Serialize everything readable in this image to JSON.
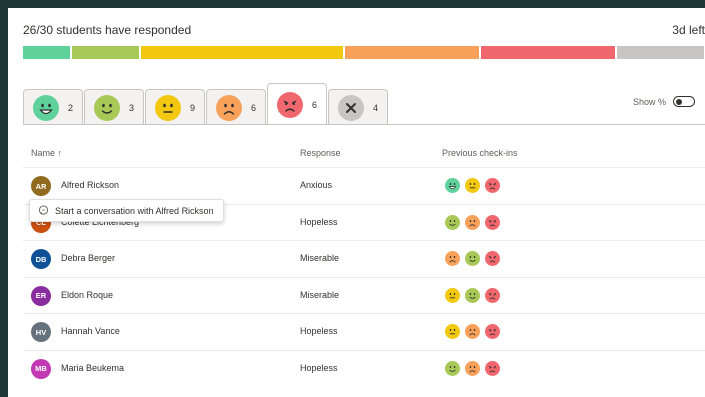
{
  "header": {
    "responded_text": "26/30 students have responded",
    "time_left": "3d left"
  },
  "progress": [
    {
      "name": "great",
      "share": 0.07,
      "color": "#5fd19a"
    },
    {
      "name": "good",
      "share": 0.1,
      "color": "#a8c957"
    },
    {
      "name": "okay",
      "share": 0.3,
      "color": "#f2c811"
    },
    {
      "name": "sad",
      "share": 0.2,
      "color": "#f7a15b"
    },
    {
      "name": "upset",
      "share": 0.2,
      "color": "#f0686e"
    },
    {
      "name": "no-response",
      "share": 0.13,
      "color": "#c8c6c4"
    }
  ],
  "tabs": [
    {
      "mood": "great",
      "count": "2",
      "icon": "grinning-face-icon",
      "color": "#5fd19a"
    },
    {
      "mood": "good",
      "count": "3",
      "icon": "smiling-face-icon",
      "color": "#a8c957"
    },
    {
      "mood": "okay",
      "count": "9",
      "icon": "neutral-face-icon",
      "color": "#f2c811"
    },
    {
      "mood": "sad",
      "count": "6",
      "icon": "frowning-face-icon",
      "color": "#f7a15b"
    },
    {
      "mood": "upset",
      "count": "6",
      "icon": "upset-face-icon",
      "color": "#f0686e",
      "active": true
    },
    {
      "mood": "no-response",
      "count": "4",
      "icon": "close-icon",
      "color": "#c8c6c4"
    }
  ],
  "show_percent": {
    "label": "Show %",
    "on": false
  },
  "table": {
    "headers": {
      "name": "Name ↑",
      "response": "Response",
      "previous": "Previous check-ins"
    },
    "rows": [
      {
        "initials": "AR",
        "avatar_color": "#8f6a1f",
        "name": "Alfred Rickson",
        "response": "Anxious",
        "previous": [
          "great",
          "okay",
          "upset"
        ]
      },
      {
        "initials": "CL",
        "avatar_color": "#ca5010",
        "name": "Colette Lichtenberg",
        "response": "Hopeless",
        "previous": [
          "good",
          "sad",
          "upset"
        ]
      },
      {
        "initials": "DB",
        "avatar_color": "#0f5196",
        "name": "Debra Berger",
        "response": "Miserable",
        "previous": [
          "sad",
          "good",
          "upset"
        ]
      },
      {
        "initials": "ER",
        "avatar_color": "#8a2d9e",
        "name": "Eldon Roque",
        "response": "Miserable",
        "previous": [
          "okay",
          "good",
          "upset"
        ]
      },
      {
        "initials": "HV",
        "avatar_color": "#66717e",
        "name": "Hannah Vance",
        "response": "Hopeless",
        "previous": [
          "okay",
          "sad",
          "upset"
        ]
      },
      {
        "initials": "MB",
        "avatar_color": "#c239b3",
        "name": "Maria Beukema",
        "response": "Hopeless",
        "previous": [
          "good",
          "sad",
          "upset"
        ]
      }
    ]
  },
  "tooltip": {
    "text": "Start a conversation with Alfred Rickson",
    "icon": "chat-bubble-icon"
  }
}
